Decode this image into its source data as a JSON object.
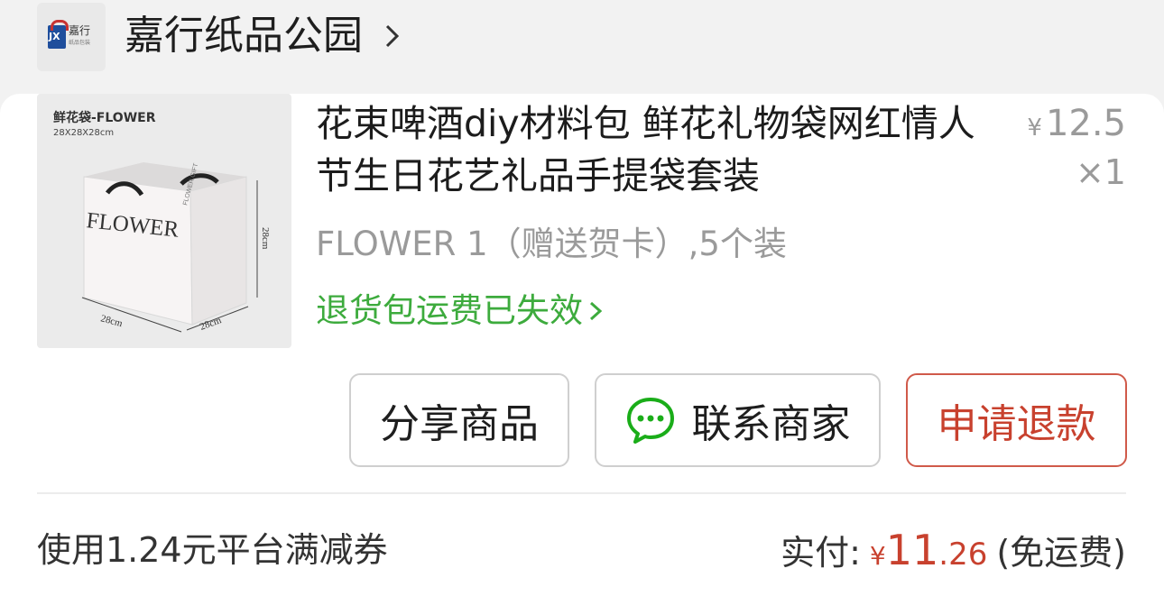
{
  "shop": {
    "name": "嘉行纸品公园",
    "logo_text": "嘉行",
    "logo_subtext": "纸品包装",
    "logo_letters": "JX"
  },
  "product": {
    "title": "花束啤酒diy材料包 鲜花礼物袋网红情人节生日花艺礼品手提袋套装",
    "spec": "FLOWER 1（赠送贺卡）,5个装",
    "return_note": "退货包运费已失效",
    "price_symbol": "¥",
    "price": "12.5",
    "quantity": "×1",
    "image": {
      "title": "鲜花袋-FLOWER",
      "size": "28X28X28cm",
      "bag_text": "FLOWER",
      "side_text": "FLOWER GIFT",
      "dim_height": "28cm",
      "dim_width": "28cm",
      "dim_depth": "28cm"
    }
  },
  "actions": {
    "share_label": "分享商品",
    "contact_label": "联系商家",
    "refund_label": "申请退款"
  },
  "footer": {
    "coupon_note": "使用1.24元平台满减券",
    "paid_label": "实付:",
    "paid_symbol": "¥",
    "paid_int": "11",
    "paid_dec": ".26",
    "shipping_note": "(免运费)"
  },
  "colors": {
    "accent_red": "#c8412e",
    "return_green": "#3dab3d",
    "wechat_green": "#1aad19"
  }
}
